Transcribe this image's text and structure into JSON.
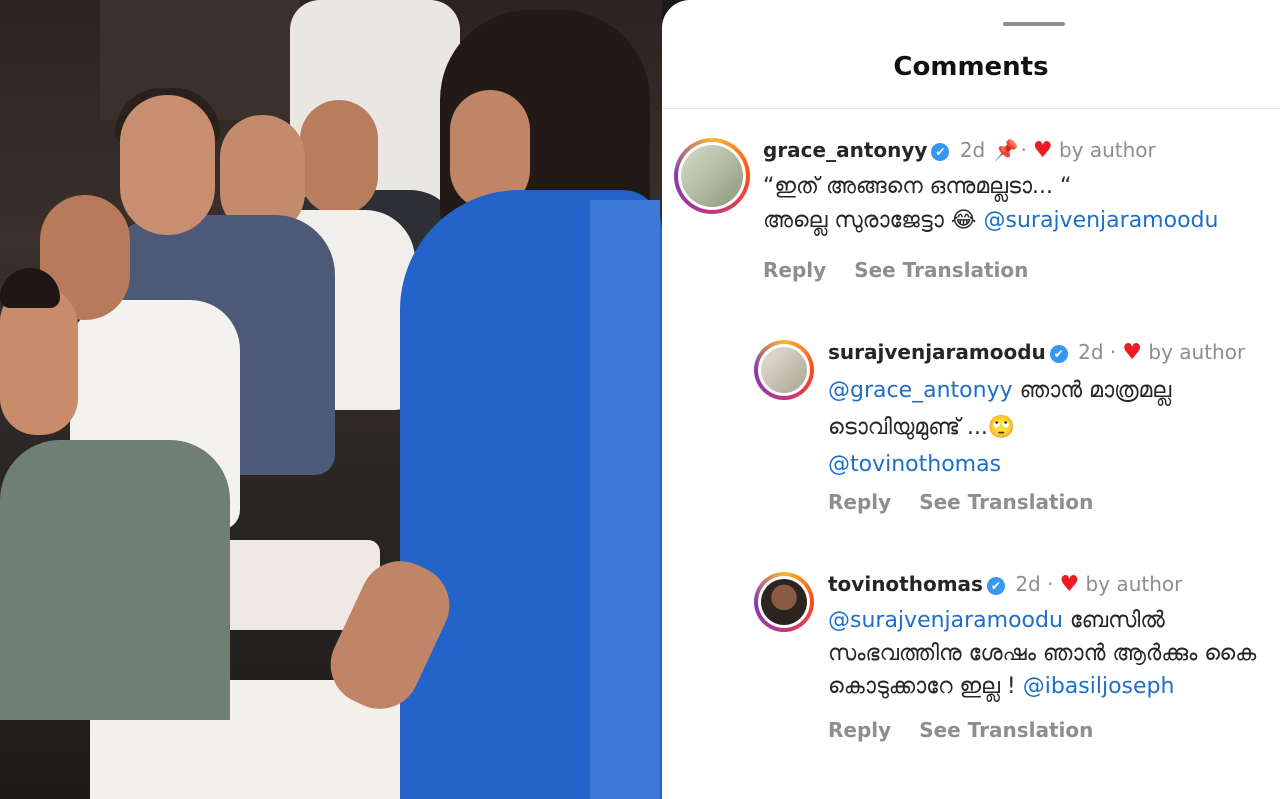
{
  "panel": {
    "title": "Comments"
  },
  "comments": [
    {
      "username": "grace_antonyy",
      "verified": "✔",
      "time": "2d",
      "pinned": "📌",
      "author_like": "by author",
      "line1": "“ഇത് അങ്ങനെ ഒന്നുമല്ലടാ... “",
      "line2_text": "അല്ലെ സുരാജേട്ടാ 😂 ",
      "line2_mention": "@surajvenjaramoodu",
      "reply": "Reply",
      "translate": "See Translation"
    },
    {
      "username": "surajvenjaramoodu",
      "verified": "✔",
      "time": "2d",
      "author_like": "by author",
      "line1_mention": "@grace_antonyy",
      "line1_text": " ഞാൻ മാത്രമല്ല",
      "line2": "ടൊവിയുമുണ്ട് ...🙄",
      "line3_mention": "@tovinothomas",
      "reply": "Reply",
      "translate": "See Translation"
    },
    {
      "username": "tovinothomas",
      "verified": "✔",
      "time": "2d",
      "author_like": "by author",
      "line1_mention": "@surajvenjaramoodu",
      "line1_text": " ബേസിൽ",
      "line2": "സംഭവത്തിനു ശേഷം  ഞാൻ ആർക്കും കൈ",
      "line3_text": "കൊടുക്കാറേ ഇല്ല ! ",
      "line3_mention": "@ibasiljoseph",
      "reply": "Reply",
      "translate": "See Translation"
    }
  ],
  "icons": {
    "heart": "♥"
  }
}
